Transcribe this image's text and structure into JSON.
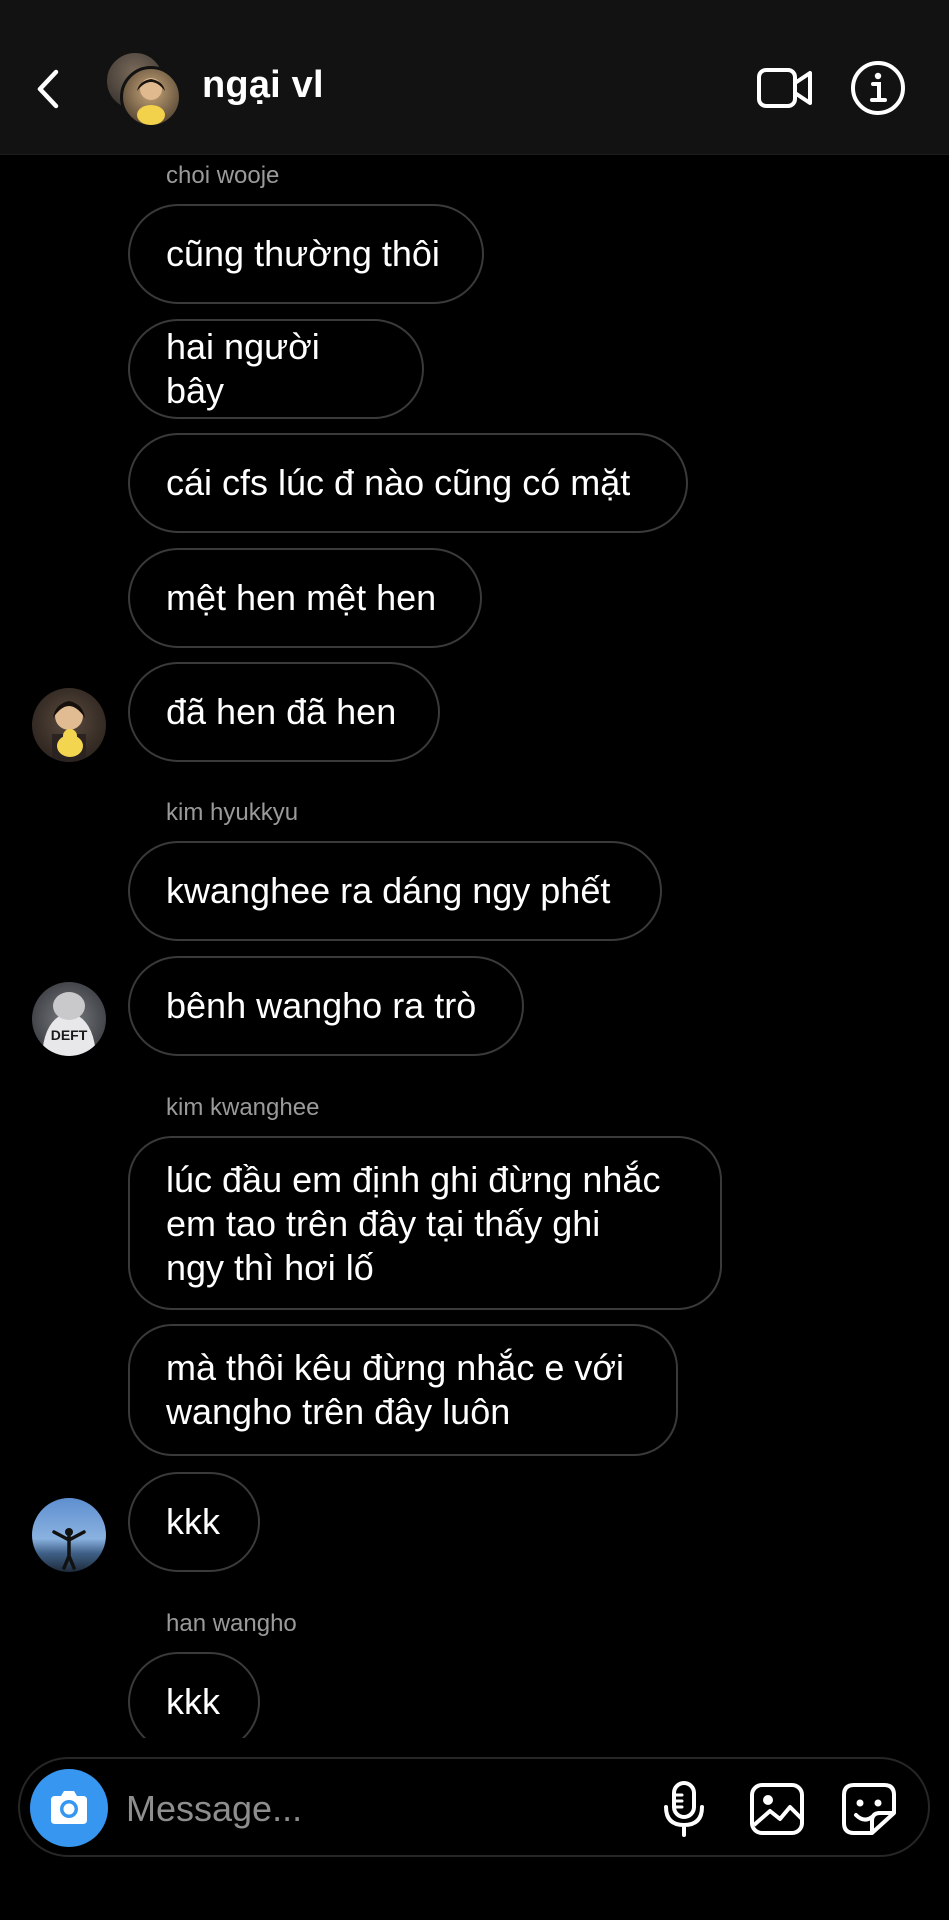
{
  "header": {
    "title": "ngại vl",
    "back_icon": "chevron-left-icon",
    "video_icon": "video-camera-icon",
    "info_icon": "info-icon"
  },
  "messages": [
    {
      "sender": "choi wooje",
      "text": "cũng thường thôi"
    },
    {
      "sender": "choi wooje",
      "text": "hai người bây"
    },
    {
      "sender": "choi wooje",
      "text": "cái cfs lúc đ nào cũng có mặt"
    },
    {
      "sender": "choi wooje",
      "text": "mệt hen mệt hen"
    },
    {
      "sender": "choi wooje",
      "text": "đã hen đã hen"
    },
    {
      "sender": "kim hyukkyu",
      "text": "kwanghee ra dáng ngy phết"
    },
    {
      "sender": "kim hyukkyu",
      "text": "bênh wangho ra trò"
    },
    {
      "sender": "kim kwanghee",
      "text": "lúc đầu em định ghi đừng nhắc\nem tao trên đây tại thấy ghi\nngy thì hơi lố"
    },
    {
      "sender": "kim kwanghee",
      "text": "mà thôi kêu đừng nhắc e với\nwangho trên đây luôn"
    },
    {
      "sender": "kim kwanghee",
      "text": "kkk"
    },
    {
      "sender": "han wangho",
      "text": "kkk"
    }
  ],
  "sender_labels": {
    "choi_wooje": "choi wooje",
    "kim_hyukkyu": "kim hyukkyu",
    "kim_kwanghee": "kim kwanghee",
    "han_wangho": "han wangho"
  },
  "avatar_texts": {
    "deft_shirt": "DEFT"
  },
  "composer": {
    "placeholder": "Message...",
    "camera_icon": "camera-icon",
    "mic_icon": "microphone-icon",
    "gallery_icon": "image-icon",
    "sticker_icon": "sticker-icon"
  },
  "colors": {
    "background": "#000000",
    "header": "#121212",
    "bubble_border": "#3a3a3a",
    "camera_button": "#3797f0",
    "sender_label": "#9a9a9a"
  }
}
